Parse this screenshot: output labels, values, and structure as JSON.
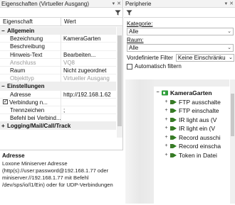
{
  "left_panel": {
    "title": "Eigenschaften (Virtueller Ausgang)",
    "buttons": [
      "▾",
      "✕"
    ],
    "grid_headers": {
      "property": "Eigenschaft",
      "value": "Wert"
    },
    "rows": [
      {
        "type": "cat",
        "toggle": "−",
        "label": "Allgemein"
      },
      {
        "type": "row",
        "p": "Bezeichnung",
        "v": "KameraGarten"
      },
      {
        "type": "row",
        "p": "Beschreibung",
        "v": ""
      },
      {
        "type": "row",
        "p": "Hinweis-Text",
        "v": "Bearbeiten..."
      },
      {
        "type": "row",
        "p": "Anschluss",
        "v": "VQ8",
        "disabled": true
      },
      {
        "type": "row",
        "p": "Raum",
        "v": "Nicht zugeordnet"
      },
      {
        "type": "row",
        "p": "Objekttyp",
        "v": "Virtueller Ausgang",
        "disabled": true
      },
      {
        "type": "cat",
        "toggle": "−",
        "label": "Einstellungen"
      },
      {
        "type": "row",
        "p": "Adresse",
        "v": "http://192.168.1.62"
      },
      {
        "type": "row",
        "p": "Verbindung n...",
        "v": "",
        "check": true
      },
      {
        "type": "row",
        "p": "Trennzeichen",
        "v": ";"
      },
      {
        "type": "row",
        "p": "Befehl bei Verbind...",
        "v": ""
      },
      {
        "type": "cat",
        "toggle": "+",
        "label": "Logging/Mail/Call/Track"
      }
    ],
    "description": {
      "title": "Adresse",
      "lines": [
        "Loxone Miniserver Adresse",
        "(http(s)://user:password@192.168.1.77 oder",
        "miniserver://192.168.1.77 mit Befehl",
        "/dev/sps/io/l1/Ein) oder für UDP-Verbindungen"
      ]
    }
  },
  "right_panel": {
    "title": "Peripherie",
    "buttons": [
      "▾",
      "✕"
    ],
    "category_label": "Kategorie:",
    "category_value": "Alle",
    "room_label": "Raum:",
    "room_value": "Alle",
    "predefined_label": "Vordefinierte Filter",
    "predefined_value": "Keine Einschränku",
    "auto_filter_label": "Automatisch filtern",
    "tree_group": "KameraGarten",
    "tree_items": [
      "FTP ausschalte",
      "FTP einschalte",
      "IR light aus (V",
      "IR light ein (V",
      "Record ausschi",
      "Record einscha",
      "Token in Datei"
    ],
    "colors": {
      "group_icon": "#2e9e3a",
      "item_icon": "#3d7a2a",
      "arrow": "#2e7d1f"
    }
  }
}
